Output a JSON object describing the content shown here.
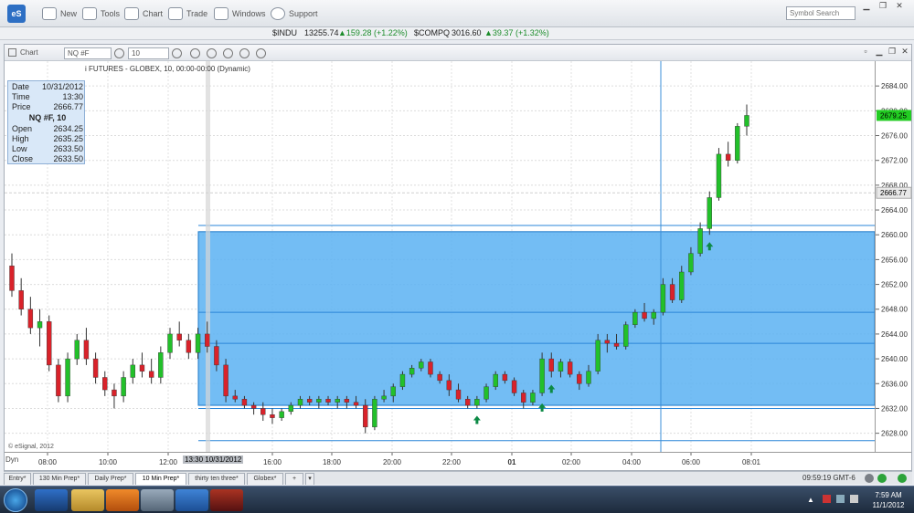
{
  "toolbar": {
    "items": [
      "New",
      "Tools",
      "Chart",
      "Trade",
      "Windows",
      "Support"
    ],
    "logo": "eS",
    "search_placeholder": "Symbol Search"
  },
  "ticker": [
    {
      "symbol": "$INDU",
      "last": "13255.74",
      "change": "159.28 (+1.22%)"
    },
    {
      "symbol": "$COMPQ",
      "last": "3016.60",
      "change": "39.37 (+1.32%)"
    }
  ],
  "chart_window": {
    "title": "Chart",
    "symbol_field": "NQ #F",
    "interval_field": "10",
    "description": "i FUTURES - GLOBEX, 10, 00:00-00:00 (Dynamic)",
    "copyright": "© eSignal, 2012",
    "dyn_label": "Dyn"
  },
  "info": {
    "date_label": "Date",
    "date": "10/31/2012",
    "time_label": "Time",
    "time": "13:30",
    "price_label": "Price",
    "price": "2666.77",
    "header": "NQ #F, 10",
    "open_label": "Open",
    "open": "2634.25",
    "high_label": "High",
    "high": "2635.25",
    "low_label": "Low",
    "low": "2633.50",
    "close_label": "Close",
    "close": "2633.50"
  },
  "x_cursor_label": "13:30 10/31/2012",
  "price_tags": {
    "last": "2679.25",
    "cursor": "2666.77"
  },
  "tabs": [
    "Entry*",
    "130 Min Prep*",
    "Daily Prep*",
    "10 Min Prep*",
    "thirty ten three*",
    "Globex*"
  ],
  "active_tab": "10 Min Prep*",
  "status_time": "09:59:19 GMT-6",
  "taskbar_clock": {
    "time": "7:59 AM",
    "date": "11/1/2012"
  },
  "colors": {
    "up": "#22c02a",
    "down": "#d9222a",
    "zone": "#5ab2f2",
    "accent": "#2d6fc4"
  },
  "chart_data": {
    "type": "candlestick",
    "ylim": [
      2625,
      2688
    ],
    "y_ticks": [
      2628,
      2632,
      2636,
      2640,
      2644,
      2648,
      2652,
      2656,
      2660,
      2664,
      2668,
      2672,
      2676,
      2680,
      2684
    ],
    "x_ticks": [
      "08:00",
      "10:00",
      "12:00",
      "16:00",
      "18:00",
      "20:00",
      "22:00",
      "01",
      "02:00",
      "04:00",
      "06:00",
      "08:01"
    ],
    "candles": [
      [
        2655,
        2657,
        2650,
        2651
      ],
      [
        2651,
        2653,
        2647,
        2648
      ],
      [
        2648,
        2650,
        2644,
        2645
      ],
      [
        2645,
        2648,
        2642,
        2646
      ],
      [
        2646,
        2647,
        2638,
        2639
      ],
      [
        2639,
        2640,
        2633,
        2634
      ],
      [
        2634,
        2641,
        2633,
        2640
      ],
      [
        2640,
        2644,
        2639,
        2643
      ],
      [
        2643,
        2645,
        2639,
        2640
      ],
      [
        2640,
        2641,
        2636,
        2637
      ],
      [
        2637,
        2638,
        2634,
        2635
      ],
      [
        2635,
        2636,
        2632,
        2634
      ],
      [
        2634,
        2638,
        2633,
        2637
      ],
      [
        2637,
        2640,
        2636,
        2639
      ],
      [
        2639,
        2641,
        2637,
        2638
      ],
      [
        2638,
        2640,
        2636,
        2637
      ],
      [
        2637,
        2642,
        2636,
        2641
      ],
      [
        2641,
        2645,
        2640,
        2644
      ],
      [
        2644,
        2646,
        2642,
        2643
      ],
      [
        2643,
        2644,
        2640,
        2641
      ],
      [
        2641,
        2645,
        2640,
        2644
      ],
      [
        2644,
        2646,
        2641,
        2642
      ],
      [
        2642,
        2643,
        2638,
        2639
      ],
      [
        2639,
        2640,
        2633,
        2634
      ],
      [
        2634,
        2635,
        2633,
        2633.5
      ],
      [
        2633.5,
        2634,
        2632,
        2632.5
      ],
      [
        2632.5,
        2633,
        2631,
        2632
      ],
      [
        2632,
        2633,
        2630,
        2631
      ],
      [
        2631,
        2632,
        2629.5,
        2630.5
      ],
      [
        2630.5,
        2632,
        2630,
        2631.5
      ],
      [
        2631.5,
        2633,
        2631,
        2632.5
      ],
      [
        2632.5,
        2634,
        2632,
        2633.5
      ],
      [
        2633.5,
        2634,
        2632.5,
        2633
      ],
      [
        2633,
        2634,
        2632,
        2633.5
      ],
      [
        2633.5,
        2634,
        2632.5,
        2633
      ],
      [
        2633,
        2634,
        2632,
        2633.5
      ],
      [
        2633.5,
        2634,
        2632,
        2633
      ],
      [
        2633,
        2634,
        2632,
        2632.5
      ],
      [
        2632.5,
        2633.5,
        2628,
        2629
      ],
      [
        2629,
        2634,
        2628.5,
        2633.5
      ],
      [
        2633.5,
        2635,
        2633,
        2634
      ],
      [
        2634,
        2636,
        2633,
        2635.5
      ],
      [
        2635.5,
        2638,
        2635,
        2637.5
      ],
      [
        2637.5,
        2639,
        2637,
        2638.5
      ],
      [
        2638.5,
        2640,
        2638,
        2639.5
      ],
      [
        2639.5,
        2640,
        2637,
        2637.5
      ],
      [
        2637.5,
        2638,
        2636,
        2636.5
      ],
      [
        2636.5,
        2637.5,
        2634,
        2635
      ],
      [
        2635,
        2636,
        2633,
        2633.5
      ],
      [
        2633.5,
        2634,
        2632,
        2632.5
      ],
      [
        2632.5,
        2634,
        2632,
        2633.5
      ],
      [
        2633.5,
        2636,
        2633,
        2635.5
      ],
      [
        2635.5,
        2638,
        2635,
        2637.5
      ],
      [
        2637.5,
        2638,
        2636,
        2636.5
      ],
      [
        2636.5,
        2637,
        2634,
        2634.5
      ],
      [
        2634.5,
        2635,
        2632,
        2633
      ],
      [
        2633,
        2635,
        2632.5,
        2634.5
      ],
      [
        2634.5,
        2641,
        2634,
        2640
      ],
      [
        2640,
        2641,
        2637,
        2638
      ],
      [
        2638,
        2640,
        2637,
        2639.5
      ],
      [
        2639.5,
        2640,
        2637,
        2637.5
      ],
      [
        2637.5,
        2638,
        2635,
        2636
      ],
      [
        2636,
        2639,
        2635.5,
        2638
      ],
      [
        2638,
        2644,
        2637.5,
        2643
      ],
      [
        2643,
        2644,
        2641,
        2642.5
      ],
      [
        2642.5,
        2644,
        2641.5,
        2642
      ],
      [
        2642,
        2646,
        2641.5,
        2645.5
      ],
      [
        2645.5,
        2648,
        2645,
        2647.5
      ],
      [
        2647.5,
        2649,
        2646,
        2646.5
      ],
      [
        2646.5,
        2648,
        2645.5,
        2647.5
      ],
      [
        2647.5,
        2653,
        2647,
        2652
      ],
      [
        2652,
        2653,
        2649,
        2649.5
      ],
      [
        2649.5,
        2655,
        2649,
        2654
      ],
      [
        2654,
        2658,
        2653.5,
        2657
      ],
      [
        2657,
        2662,
        2656.5,
        2661
      ],
      [
        2661,
        2667,
        2660,
        2666
      ],
      [
        2666,
        2674,
        2665.5,
        2673
      ],
      [
        2673,
        2675,
        2671,
        2672
      ],
      [
        2672,
        2678,
        2671.5,
        2677.5
      ],
      [
        2677.5,
        2681,
        2676,
        2679.25
      ]
    ],
    "zone": {
      "top": 2660.5,
      "bottom": 2632.5
    },
    "horizontal_lines": [
      2661.5,
      2647.5,
      2642.5,
      2632,
      2626.8
    ],
    "cursor_price": 2666.77,
    "signals_up": [
      50,
      57,
      58,
      75
    ]
  }
}
